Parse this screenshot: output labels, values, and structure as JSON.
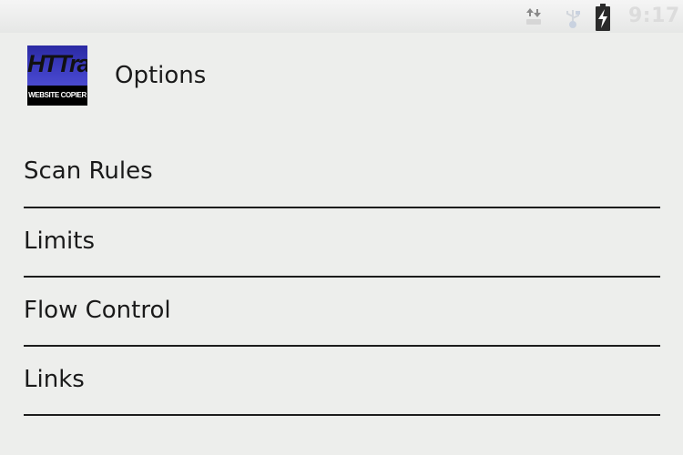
{
  "status_bar": {
    "clock": "9:17",
    "icons": [
      "sync-icon",
      "usb-icon",
      "battery-charging-icon"
    ]
  },
  "title_bar": {
    "title": "Options",
    "logo": {
      "top_text": "HTTrack",
      "bottom_text": "WEBSITE COPIER"
    }
  },
  "menu": {
    "items": [
      {
        "label": "Scan Rules"
      },
      {
        "label": "Limits"
      },
      {
        "label": "Flow Control"
      },
      {
        "label": "Links"
      }
    ]
  },
  "colors": {
    "background": "#edeeec",
    "text": "#1a1a1a",
    "divider": "#1c1c1c",
    "logo_blue": "#4242c8"
  }
}
